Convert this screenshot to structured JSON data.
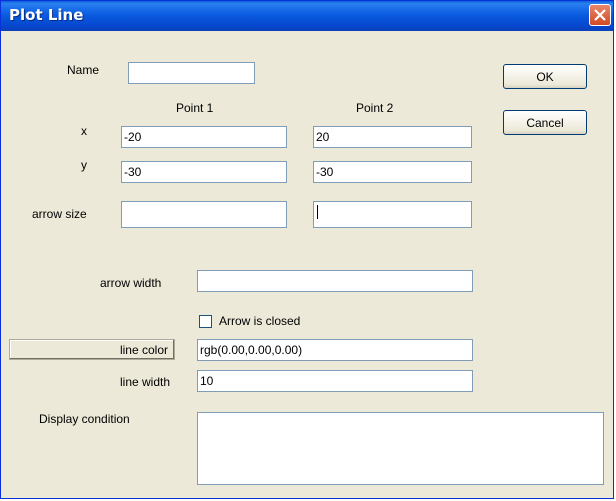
{
  "window": {
    "title": "Plot Line"
  },
  "buttons": {
    "ok": "OK",
    "cancel": "Cancel",
    "line_color": "line color"
  },
  "labels": {
    "name": "Name",
    "point1": "Point 1",
    "point2": "Point 2",
    "x": "x",
    "y": "y",
    "arrow_size": "arrow size",
    "arrow_width": "arrow width",
    "line_width": "line width",
    "display_condition": "Display condition",
    "arrow_closed": "Arrow is closed"
  },
  "fields": {
    "name": "",
    "x1": "-20",
    "x2": "20",
    "y1": "-30",
    "y2": "-30",
    "arrow_size1": "",
    "arrow_size2": "",
    "arrow_width": "",
    "line_color": "rgb(0.00,0.00,0.00)",
    "line_width": "10",
    "display_condition": ""
  },
  "checkbox": {
    "arrow_closed": false
  }
}
